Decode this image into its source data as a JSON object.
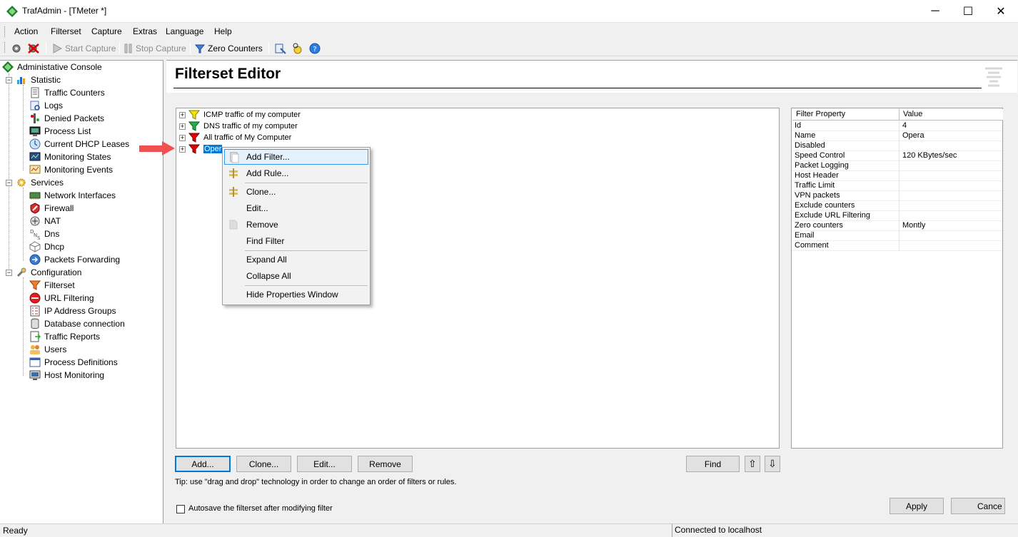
{
  "window": {
    "title": "TrafAdmin - [TMeter *]",
    "minimize": "─",
    "maximize": "☐",
    "close": "✕"
  },
  "menu": [
    "Action",
    "Filterset",
    "Capture",
    "Extras",
    "Language",
    "Help"
  ],
  "toolbar": {
    "start_capture": "Start Capture",
    "stop_capture": "Stop Capture",
    "zero_counters": "Zero Counters"
  },
  "sidebar": {
    "root": "Administative Console",
    "statistic": {
      "label": "Statistic",
      "items": [
        "Traffic Counters",
        "Logs",
        "Denied Packets",
        "Process List",
        "Current DHCP Leases",
        "Monitoring States",
        "Monitoring Events"
      ]
    },
    "services": {
      "label": "Services",
      "items": [
        "Network Interfaces",
        "Firewall",
        "NAT",
        "Dns",
        "Dhcp",
        "Packets Forwarding"
      ]
    },
    "configuration": {
      "label": "Configuration",
      "items": [
        "Filterset",
        "URL Filtering",
        "IP Address Groups",
        "Database connection",
        "Traffic Reports",
        "Users",
        "Process Definitions",
        "Host Monitoring"
      ]
    }
  },
  "editor": {
    "title": "Filterset Editor",
    "filters": [
      {
        "label": "ICMP traffic of my computer",
        "color": "#f2e600"
      },
      {
        "label": "DNS traffic of my computer",
        "color": "#22b14c"
      },
      {
        "label": "All traffic of My Computer",
        "color": "#e00000"
      },
      {
        "label": "Oper",
        "color": "#e00000",
        "selected": true
      }
    ],
    "context_menu": [
      "Add Filter...",
      "Add Rule...",
      "Clone...",
      "Edit...",
      "Remove",
      "Find Filter",
      "Expand All",
      "Collapse All",
      "Hide Properties Window"
    ],
    "properties": {
      "col_property": "Filter Property",
      "col_value": "Value",
      "rows": [
        {
          "k": "Id",
          "v": "4"
        },
        {
          "k": "Name",
          "v": "Opera"
        },
        {
          "k": "Disabled",
          "v": ""
        },
        {
          "k": "Speed Control",
          "v": "120 KBytes/sec"
        },
        {
          "k": "Packet Logging",
          "v": ""
        },
        {
          "k": "Host Header",
          "v": ""
        },
        {
          "k": "Traffic Limit",
          "v": ""
        },
        {
          "k": "VPN packets",
          "v": ""
        },
        {
          "k": "Exclude counters",
          "v": ""
        },
        {
          "k": "Exclude URL Filtering",
          "v": ""
        },
        {
          "k": "Zero counters",
          "v": "Montly"
        },
        {
          "k": "Email",
          "v": ""
        },
        {
          "k": "Comment",
          "v": ""
        }
      ]
    },
    "buttons": {
      "add": "Add...",
      "clone": "Clone...",
      "edit": "Edit...",
      "remove": "Remove",
      "find": "Find",
      "up": "⇧",
      "down": "⇩",
      "apply": "Apply",
      "cancel": "Cance"
    },
    "tip": "Tip: use \"drag and drop\" technology in order to change an order of filters or rules.",
    "autosave_label": "Autosave the filterset after modifying filter"
  },
  "status": {
    "left": "Ready",
    "right": "Connected to localhost"
  }
}
